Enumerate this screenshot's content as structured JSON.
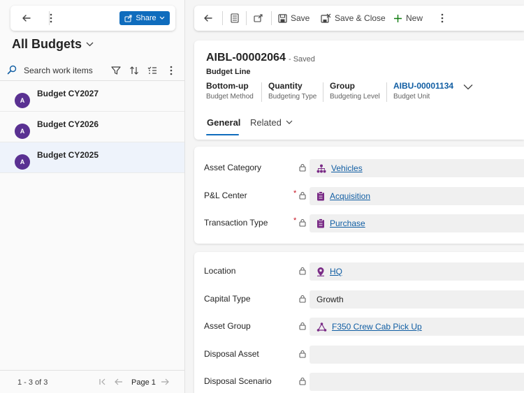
{
  "left_pane": {
    "share_label": "Share",
    "view_title": "All Budgets",
    "search_placeholder": "Search work items",
    "items": [
      {
        "initial": "A",
        "label": "Budget CY2027"
      },
      {
        "initial": "A",
        "label": "Budget CY2026"
      },
      {
        "initial": "A",
        "label": "Budget CY2025",
        "selected": true
      }
    ],
    "footer": {
      "count": "1 - 3 of 3",
      "page": "Page 1"
    }
  },
  "command_bar": {
    "save_label": "Save",
    "save_close_label": "Save & Close",
    "new_label": "New"
  },
  "record": {
    "title": "AIBL-00002064",
    "status": "- Saved",
    "entity": "Budget Line",
    "header_fields": [
      {
        "value": "Bottom-up",
        "label": "Budget Method"
      },
      {
        "value": "Quantity",
        "label": "Budgeting Type"
      },
      {
        "value": "Group",
        "label": "Budgeting Level"
      },
      {
        "value": "AIBU-00001134",
        "label": "Budget Unit"
      }
    ],
    "tabs": [
      {
        "label": "General",
        "active": true
      },
      {
        "label": "Related"
      }
    ]
  },
  "section1": [
    {
      "label": "Asset Category",
      "required": false,
      "value": "Vehicles",
      "link": true,
      "icon": "hierarchy-icon"
    },
    {
      "label": "P&L Center",
      "required": true,
      "value": "Acquisition",
      "link": true,
      "icon": "clipboard-icon"
    },
    {
      "label": "Transaction Type",
      "required": true,
      "value": "Purchase",
      "link": true,
      "icon": "clipboard-icon"
    }
  ],
  "section2": [
    {
      "label": "Location",
      "value": "HQ",
      "link": true,
      "icon": "location-pin-icon"
    },
    {
      "label": "Capital Type",
      "value": "Growth",
      "link": false
    },
    {
      "label": "Asset Group",
      "value": "F350 Crew Cab Pick Up",
      "link": true,
      "icon": "asset-group-icon"
    },
    {
      "label": "Disposal Asset",
      "value": "",
      "link": false
    },
    {
      "label": "Disposal Scenario",
      "value": "",
      "link": false
    }
  ],
  "colors": {
    "accent": "#0f6cbd",
    "avatar": "#5a3192",
    "lookup_icon": "#7a2b86",
    "required": "#c50f1f"
  }
}
